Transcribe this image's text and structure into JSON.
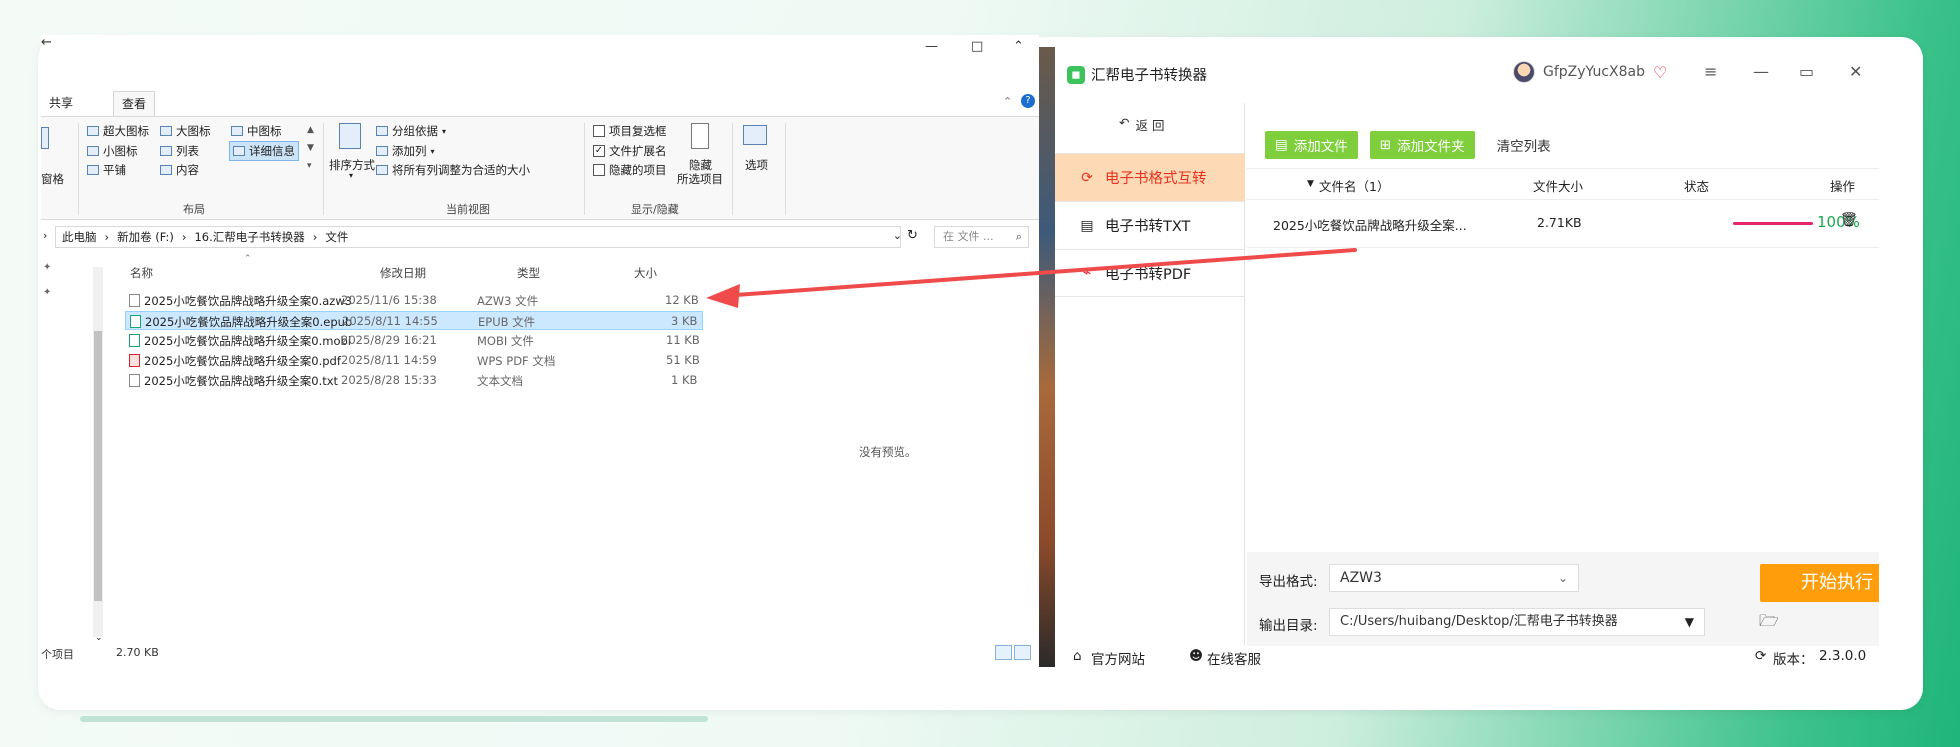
{
  "explorer": {
    "tabs": [
      "共享",
      "查看"
    ],
    "active_tab": "查看",
    "ribbon": {
      "pane_label": "窗格",
      "layout": {
        "items": [
          "超大图标",
          "大图标",
          "中图标",
          "小图标",
          "列表",
          "详细信息",
          "平铺",
          "内容"
        ],
        "selected": "详细信息",
        "group_label": "布局"
      },
      "view": {
        "sort_label": "排序方式",
        "group_by": "分组依据",
        "add_column": "添加列",
        "fit_columns": "将所有列调整为合适的大小",
        "group_label": "当前视图"
      },
      "show_hide": {
        "item_checkbox": "项目复选框",
        "file_ext": "文件扩展名",
        "hidden_items": "隐藏的项目",
        "hide_selected": "隐藏",
        "hide_selected2": "所选项目",
        "group_label": "显示/隐藏"
      },
      "options": "选项"
    },
    "breadcrumb": [
      "此电脑",
      "新加卷 (F:)",
      "16.汇帮电子书转换器",
      "文件"
    ],
    "search_placeholder": "在 文件 ...",
    "columns": [
      "名称",
      "修改日期",
      "类型",
      "大小"
    ],
    "files": [
      {
        "name": "2025小吃餐饮品牌战略升级全案0.azw3",
        "date": "2025/11/6 15:38",
        "type": "AZW3 文件",
        "size": "12 KB"
      },
      {
        "name": "2025小吃餐饮品牌战略升级全案0.epub",
        "date": "2025/8/11 14:55",
        "type": "EPUB 文件",
        "size": "3 KB"
      },
      {
        "name": "2025小吃餐饮品牌战略升级全案0.mobi",
        "date": "2025/8/29 16:21",
        "type": "MOBI 文件",
        "size": "11 KB"
      },
      {
        "name": "2025小吃餐饮品牌战略升级全案0.pdf",
        "date": "2025/8/11 14:59",
        "type": "WPS PDF 文档",
        "size": "51 KB"
      },
      {
        "name": "2025小吃餐饮品牌战略升级全案0.txt",
        "date": "2025/8/28 15:33",
        "type": "文本文档",
        "size": "1 KB"
      }
    ],
    "no_preview": "没有预览。",
    "status_items": "个项目",
    "status_size": "2.70 KB"
  },
  "converter": {
    "title": "汇帮电子书转换器",
    "username": "GfpZyYucX8ab",
    "back_label": "返 回",
    "nav": [
      "电子书格式互转",
      "电子书转TXT",
      "电子书转PDF"
    ],
    "toolbar": {
      "add_file": "添加文件",
      "add_folder": "添加文件夹",
      "clear": "清空列表"
    },
    "table": {
      "headers": [
        "文件名（1）",
        "文件大小",
        "状态",
        "操作"
      ],
      "rows": [
        {
          "name": "2025小吃餐饮品牌战略升级全案...",
          "size": "2.71KB",
          "progress": "100%"
        }
      ]
    },
    "export_label": "导出格式:",
    "export_value": "AZW3",
    "output_label": "输出目录:",
    "output_value": "C:/Users/huibang/Desktop/汇帮电子书转换器",
    "start_button": "开始执行",
    "footer": {
      "website": "官方网站",
      "support": "在线客服",
      "version_label": "版本：",
      "version": "2.3.0.0"
    }
  },
  "colors": {
    "accent_orange": "#ff9d0a",
    "accent_green": "#7ecf3b",
    "active_nav_bg": "#fdd9b6",
    "active_nav_text": "#e8321d",
    "arrow": "#ef4b4b"
  }
}
